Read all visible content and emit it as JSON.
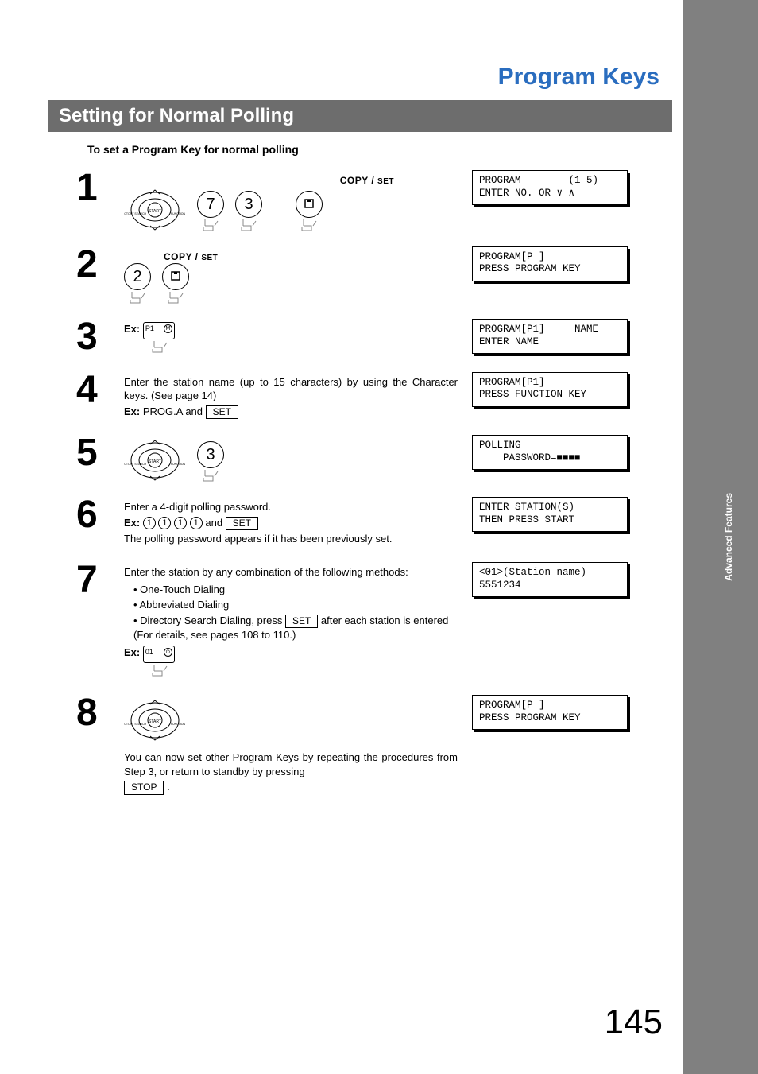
{
  "page_title": "Program Keys",
  "section_title": "Setting for Normal Polling",
  "subhead": "To set a Program Key for normal polling",
  "side_tab": "Advanced\nFeatures",
  "page_number": "145",
  "labels": {
    "copy_set_copy": "COPY",
    "copy_set_set": "SET",
    "ex": "Ex:",
    "set_btn": "SET",
    "stop_btn": "STOP",
    "and": " and "
  },
  "steps": {
    "s1": {
      "num": "1",
      "keys": [
        "7",
        "3"
      ],
      "lcd": "PROGRAM        (1-5)\nENTER NO. OR ∨ ∧"
    },
    "s2": {
      "num": "2",
      "keys": [
        "2"
      ],
      "lcd": "PROGRAM[P ]\nPRESS PROGRAM KEY"
    },
    "s3": {
      "num": "3",
      "pk_label": "P1",
      "pk_corner": "M",
      "lcd": "PROGRAM[P1]     NAME\nENTER NAME"
    },
    "s4": {
      "num": "4",
      "text_a": "Enter the station name (up to 15 characters) by using the Character keys. (See page 14)",
      "ex_text": "PROG.A and ",
      "lcd": "PROGRAM[P1]\nPRESS FUNCTION KEY"
    },
    "s5": {
      "num": "5",
      "keys": [
        "3"
      ],
      "lcd": "POLLING\n    PASSWORD=■■■■"
    },
    "s6": {
      "num": "6",
      "text_a": "Enter a 4-digit polling password.",
      "ex_digits": [
        "1",
        "1",
        "1",
        "1"
      ],
      "text_b": "The polling password appears if it has been previously set.",
      "lcd": "ENTER STATION(S)\nTHEN PRESS START"
    },
    "s7": {
      "num": "7",
      "text_a": "Enter the station by any combination of the following methods:",
      "methods": [
        "One-Touch Dialing",
        "Abbreviated Dialing"
      ],
      "dir_a": "Directory Search Dialing, press ",
      "dir_b": " after each station is entered",
      "details": "(For details, see pages 108 to 110.)",
      "pk_label": "01",
      "pk_corner": "⊙",
      "lcd": "<01>(Station name)\n5551234"
    },
    "s8": {
      "num": "8",
      "text_a": "You can now set other Program Keys by repeating the procedures from Step 3, or return to standby by pressing",
      "lcd": "PROGRAM[P ]\nPRESS PROGRAM KEY"
    }
  }
}
